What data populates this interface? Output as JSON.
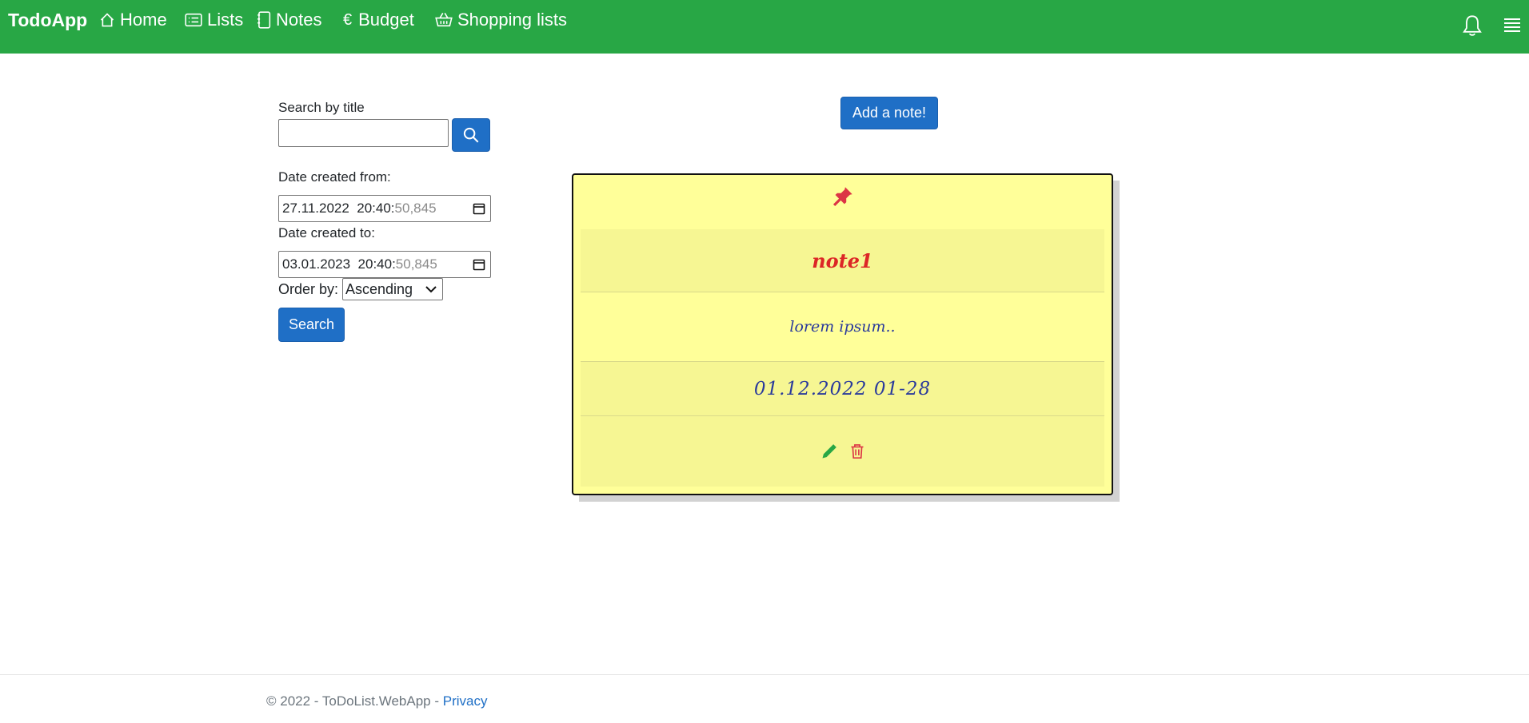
{
  "navbar": {
    "brand": "TodoApp",
    "items": [
      {
        "label": "Home",
        "icon": "house-icon"
      },
      {
        "label": "Lists",
        "icon": "card-list-icon"
      },
      {
        "label": "Notes",
        "icon": "journal-icon"
      },
      {
        "label": "Budget",
        "icon": "euro-icon"
      },
      {
        "label": "Shopping lists",
        "icon": "basket-icon"
      }
    ],
    "bell_icon": "bell-icon",
    "menu_icon": "hamburger-icon",
    "color": "#28a745"
  },
  "filters": {
    "search_label": "Search by title",
    "search_value": "",
    "date_from_label": "Date created from:",
    "date_from_value": "27.11.2022  20:40:",
    "date_from_ghost": "50,845",
    "date_to_label": "Date created to:",
    "date_to_value": "03.01.2023  20:40:",
    "date_to_ghost": "50,845",
    "order_label": "Order by:",
    "order_value": "Ascending",
    "search_button": "Search"
  },
  "add_note_button": "Add a note!",
  "note": {
    "title": "note1",
    "body": "lorem ipsum..",
    "date": "01.12.2022 01-28",
    "pin_icon": "pin-icon",
    "edit_icon": "pencil-icon",
    "delete_icon": "trash-icon"
  },
  "footer": {
    "text": "© 2022 - ToDoList.WebApp - ",
    "privacy": "Privacy"
  }
}
